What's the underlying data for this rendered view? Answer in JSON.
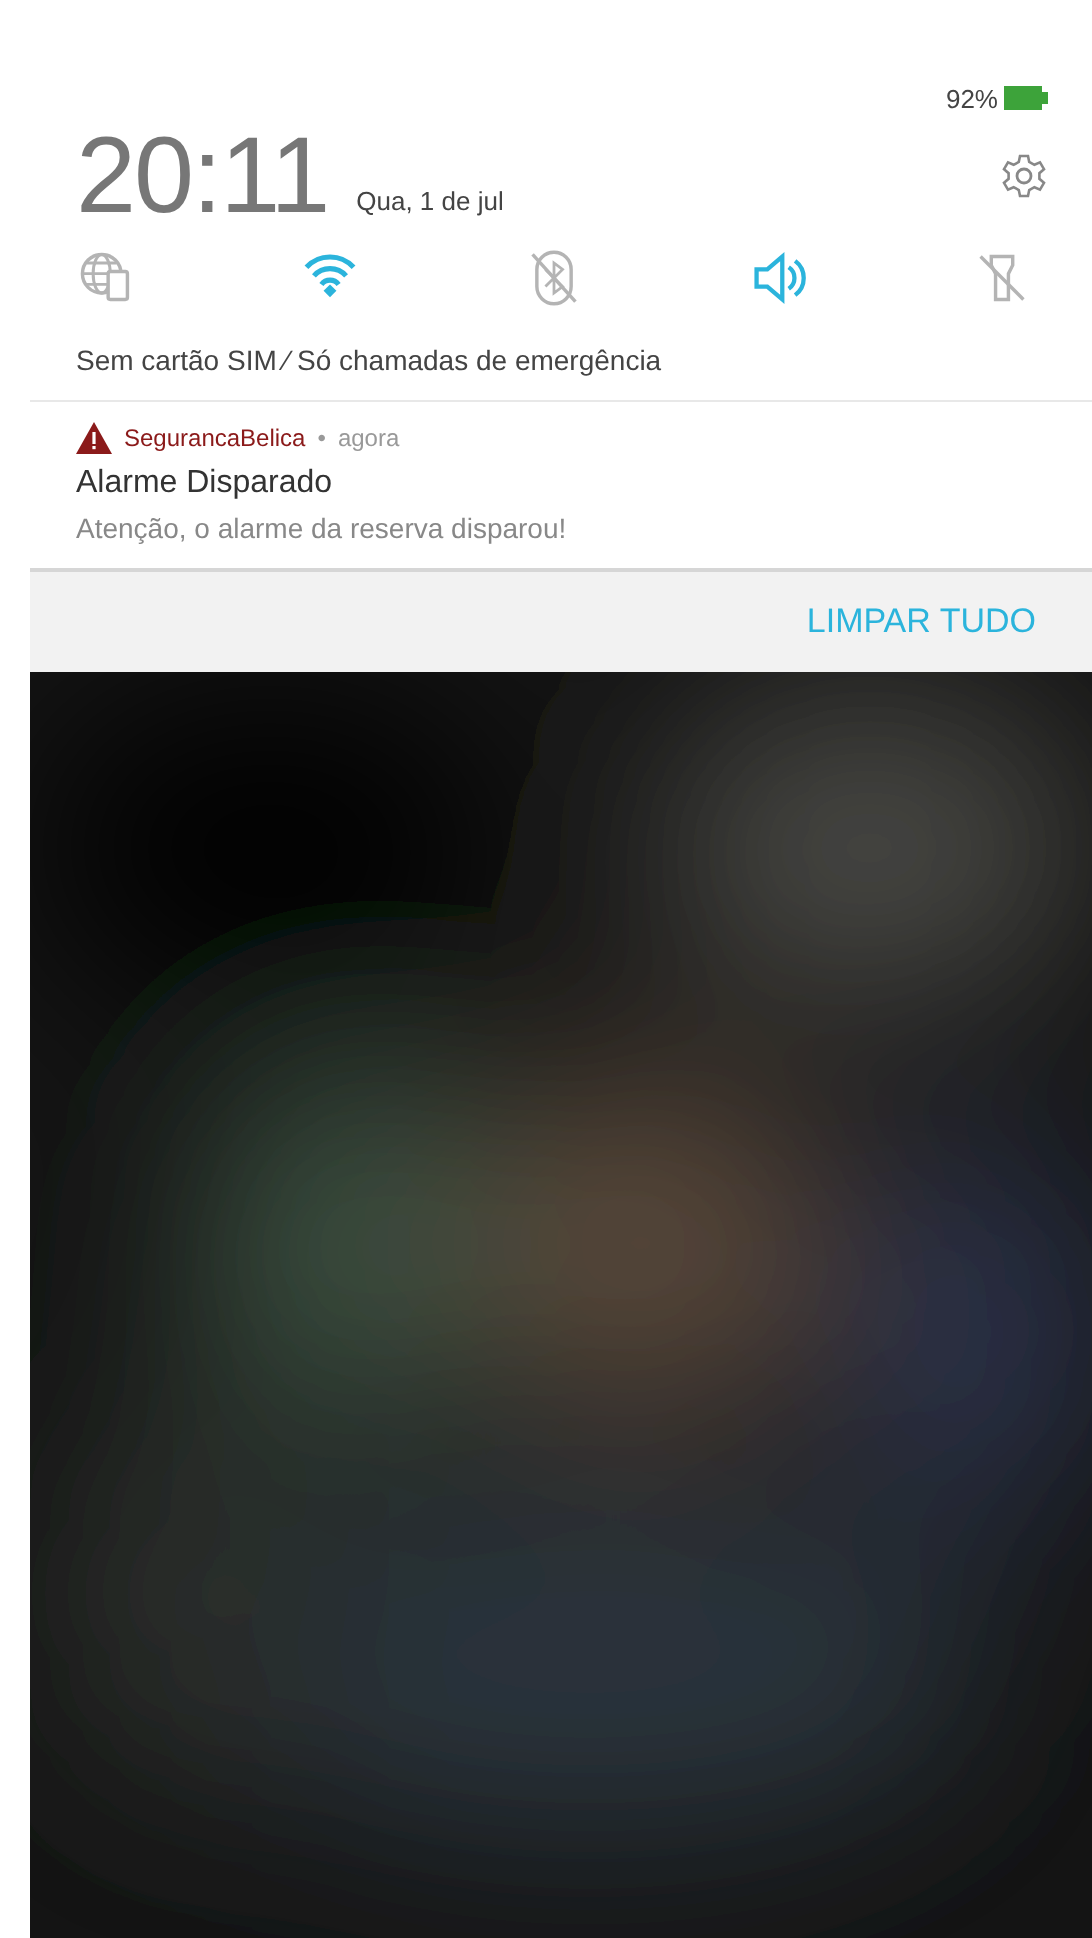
{
  "status_bar": {
    "battery": "92%"
  },
  "header": {
    "time": "20:11",
    "date": "Qua, 1 de jul"
  },
  "quick_tiles": [
    {
      "kind": "data",
      "on": false
    },
    {
      "kind": "wifi",
      "on": true
    },
    {
      "kind": "bluetooth",
      "on": false
    },
    {
      "kind": "sound",
      "on": true
    },
    {
      "kind": "flashlight",
      "on": false
    }
  ],
  "carrier": "Sem cartão SIM ∕ Só chamadas de emergência",
  "notification": {
    "app": "SegurancaBelica",
    "separator": "•",
    "time": "agora",
    "title": "Alarme Disparado",
    "text": "Atenção, o alarme da reserva disparou!"
  },
  "clear_button": "LIMPAR TUDO"
}
